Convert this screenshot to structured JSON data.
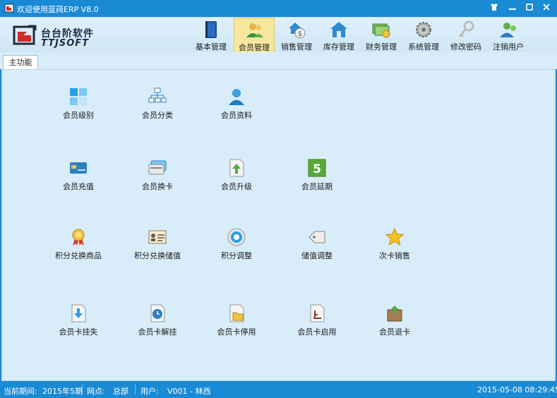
{
  "window": {
    "title": "欢迎使用蓝莼ERP V8.0"
  },
  "logo": {
    "cn": "台台阶软件",
    "en": "TTJSOFT"
  },
  "nav": [
    {
      "label": "基本管理",
      "icon": "book-icon",
      "active": false
    },
    {
      "label": "会员管理",
      "icon": "members-icon",
      "active": true
    },
    {
      "label": "销售管理",
      "icon": "sales-icon",
      "active": false
    },
    {
      "label": "库存管理",
      "icon": "warehouse-icon",
      "active": false
    },
    {
      "label": "财务管理",
      "icon": "money-icon",
      "active": false
    },
    {
      "label": "系统管理",
      "icon": "gear-icon",
      "active": false
    },
    {
      "label": "修改密码",
      "icon": "key-icon",
      "active": false
    },
    {
      "label": "注销用户",
      "icon": "logout-user-icon",
      "active": false
    }
  ],
  "tabs": {
    "main": "主功能"
  },
  "items": [
    {
      "label": "会员级别",
      "icon": "grid-icon"
    },
    {
      "label": "会员分类",
      "icon": "hierarchy-icon"
    },
    {
      "label": "会员资料",
      "icon": "user-icon"
    },
    {
      "label": "会员充值",
      "icon": "card-icon"
    },
    {
      "label": "会员换卡",
      "icon": "card-swap-icon"
    },
    {
      "label": "会员升级",
      "icon": "upgrade-icon"
    },
    {
      "label": "会员延期",
      "icon": "calendar-5-icon"
    },
    {
      "label": "积分兑换商品",
      "icon": "medal-icon"
    },
    {
      "label": "积分兑换储值",
      "icon": "id-card-icon"
    },
    {
      "label": "积分调整",
      "icon": "disc-icon"
    },
    {
      "label": "储值调整",
      "icon": "tag-icon"
    },
    {
      "label": "次卡销售",
      "icon": "star-icon"
    },
    {
      "label": "会员卡挂失",
      "icon": "doc-down-icon"
    },
    {
      "label": "会员卡解挂",
      "icon": "doc-clock-icon"
    },
    {
      "label": "会员卡停用",
      "icon": "doc-folder-icon"
    },
    {
      "label": "会员卡启用",
      "icon": "doc-chart-icon"
    },
    {
      "label": "会员退卡",
      "icon": "box-return-icon"
    }
  ],
  "status": {
    "period_label": "当前期间:",
    "period_value": "2015年5期",
    "branch_label": "网点:",
    "branch_value": "总部",
    "user_label": "用户:",
    "user_value": "V001 - 林西",
    "datetime": "2015-05-08 08:29:45"
  },
  "colors": {
    "titlebar": "#1a8ad4",
    "content_bg": "#d9ecf9",
    "active_nav": "#f5e7a0"
  }
}
